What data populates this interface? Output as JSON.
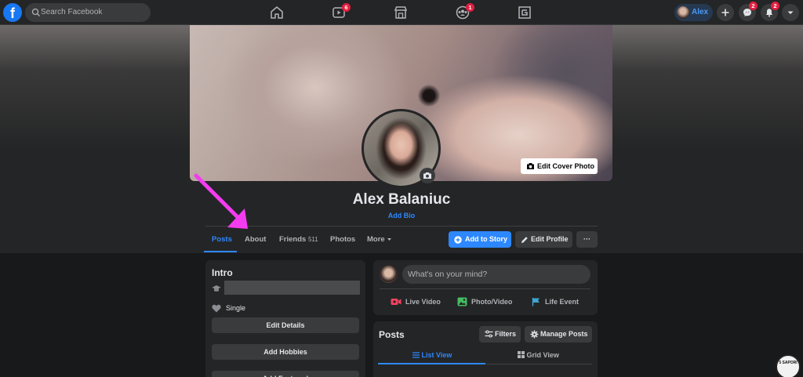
{
  "topnav": {
    "search_placeholder": "Search Facebook",
    "watch_badge": "6",
    "groups_badge": "1",
    "user_name": "Alex",
    "messenger_badge": "2",
    "notifications_badge": "2"
  },
  "profile": {
    "edit_cover_label": "Edit Cover Photo",
    "name": "Alex Balaniuc",
    "add_bio": "Add Bio"
  },
  "tabs": {
    "posts": "Posts",
    "about": "About",
    "friends": "Friends",
    "friends_count": "511",
    "photos": "Photos",
    "more": "More"
  },
  "actions": {
    "add_to_story": "Add to Story",
    "edit_profile": "Edit Profile",
    "more_dots": "···"
  },
  "intro": {
    "title": "Intro",
    "relationship": "Single",
    "edit_details": "Edit Details",
    "add_hobbies": "Add Hobbies",
    "add_featured": "Add Featured"
  },
  "composer": {
    "placeholder": "What's on your mind?",
    "live_video": "Live Video",
    "photo_video": "Photo/Video",
    "life_event": "Life Event"
  },
  "posts_section": {
    "title": "Posts",
    "filters": "Filters",
    "manage_posts": "Manage Posts",
    "list_view": "List View",
    "grid_view": "Grid View"
  },
  "watermark": {
    "text": "5 SAPORI"
  },
  "colors": {
    "accent": "#2d88ff",
    "annotation_arrow": "#f33cf0",
    "badge": "#e41e3f"
  }
}
